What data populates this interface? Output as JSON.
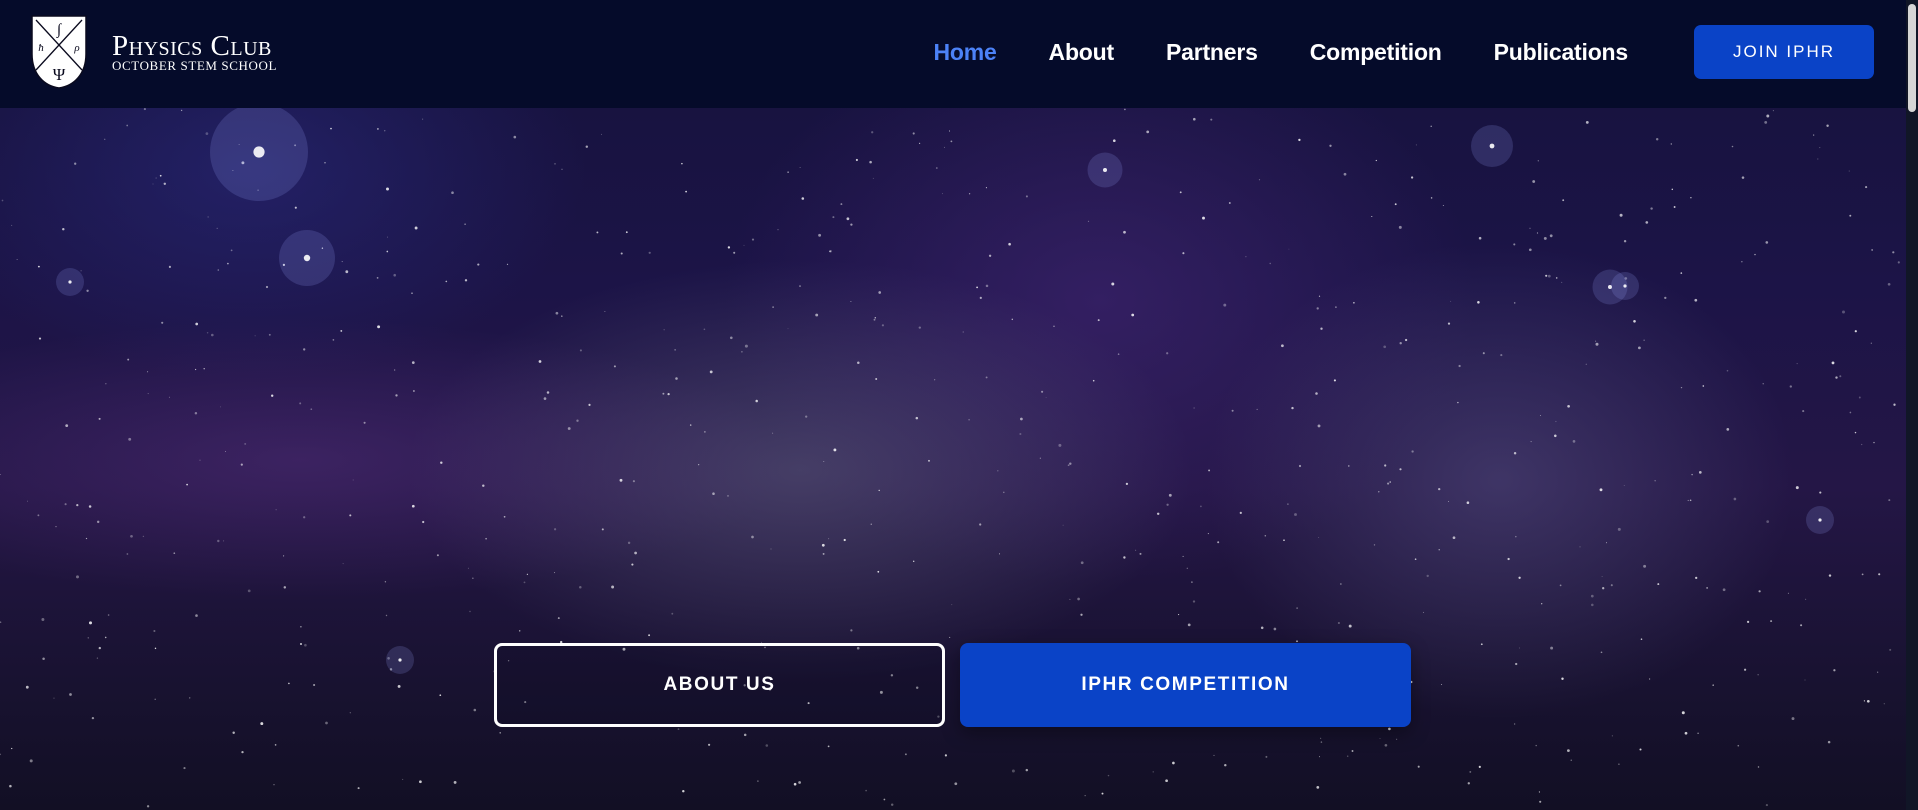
{
  "brand": {
    "title": "Physics Club",
    "subtitle": "OCTOBER STEM SCHOOL",
    "logo_icon": "physics-shield-icon",
    "logo_symbols": {
      "top": "∫",
      "left": "ħ",
      "right": "ρ",
      "bottom": "Ψ"
    }
  },
  "nav": {
    "items": [
      {
        "label": "Home",
        "active": true
      },
      {
        "label": "About",
        "active": false
      },
      {
        "label": "Partners",
        "active": false
      },
      {
        "label": "Competition",
        "active": false
      },
      {
        "label": "Publications",
        "active": false
      }
    ],
    "cta_label": "JOIN IPHR"
  },
  "hero": {
    "about_label": "ABOUT US",
    "competition_label": "IPHR COMPETITION",
    "background": "starry-nebula-sky"
  },
  "colors": {
    "header_bg": "#050b2a",
    "accent": "#0a43c7",
    "active_nav": "#4c82f7",
    "text": "#ffffff"
  }
}
